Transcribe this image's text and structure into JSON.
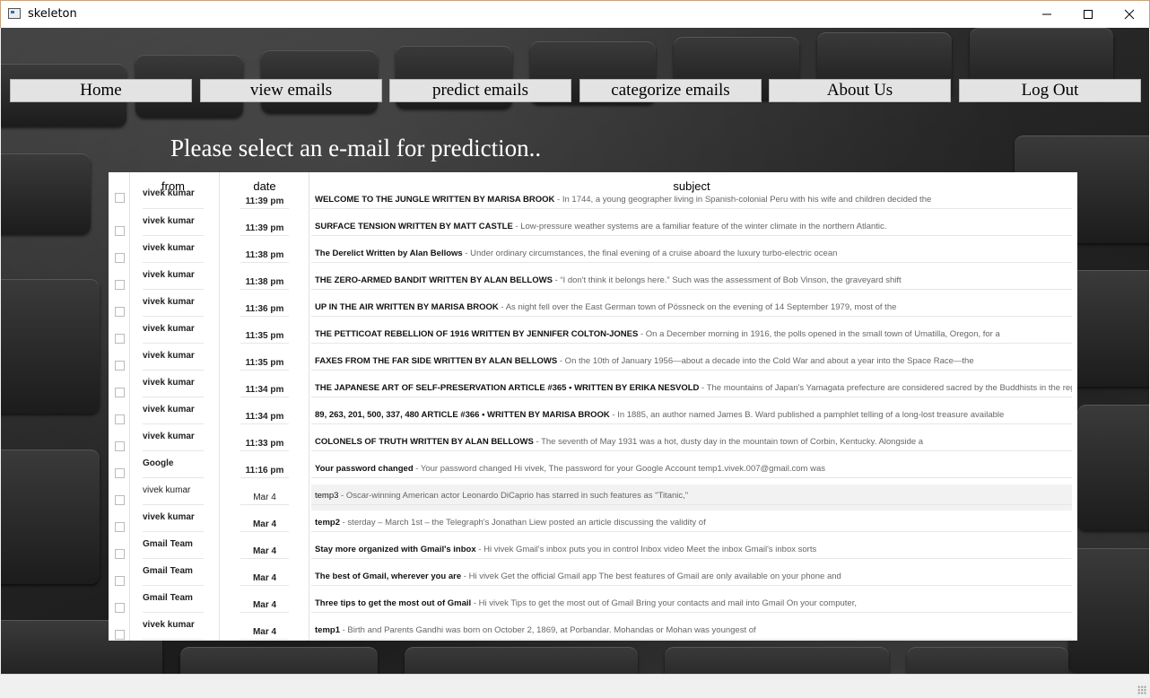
{
  "window": {
    "title": "skeleton"
  },
  "nav": [
    {
      "label": "Home"
    },
    {
      "label": "view emails"
    },
    {
      "label": "predict emails"
    },
    {
      "label": "categorize emails"
    },
    {
      "label": "About Us"
    },
    {
      "label": "Log Out"
    }
  ],
  "prompt": "Please select an e-mail for prediction..",
  "table": {
    "headers": {
      "from": "from",
      "date": "date",
      "subject": "subject"
    },
    "rows": [
      {
        "from": "vivek kumar",
        "date": "11:39 pm",
        "subject": "WELCOME TO THE JUNGLE WRITTEN BY MARISA BROOK",
        "snippet": " - In 1744, a young geographer living in Spanish-colonial Peru with his wife and children decided the",
        "read": false
      },
      {
        "from": "vivek kumar",
        "date": "11:39 pm",
        "subject": "SURFACE TENSION WRITTEN BY MATT CASTLE",
        "snippet": " - Low-pressure weather systems are a familiar feature of the winter climate in the northern Atlantic.",
        "read": false
      },
      {
        "from": "vivek kumar",
        "date": "11:38 pm",
        "subject": "The Derelict Written by Alan Bellows",
        "snippet": " - Under ordinary circumstances, the final evening of a cruise aboard the luxury turbo-electric ocean",
        "read": false
      },
      {
        "from": "vivek kumar",
        "date": "11:38 pm",
        "subject": "THE ZERO-ARMED BANDIT WRITTEN BY ALAN BELLOWS",
        "snippet": " - “I don't think it belongs here.” Such was the assessment of Bob Vinson, the graveyard shift",
        "read": false
      },
      {
        "from": "vivek kumar",
        "date": "11:36 pm",
        "subject": "UP IN THE AIR WRITTEN BY MARISA BROOK",
        "snippet": " - As night fell over the East German town of Pössneck on the evening of 14 September 1979, most of the",
        "read": false
      },
      {
        "from": "vivek kumar",
        "date": "11:35 pm",
        "subject": "THE PETTICOAT REBELLION OF 1916 WRITTEN BY JENNIFER COLTON-JONES",
        "snippet": " - On a December morning in 1916, the polls opened in the small town of Umatilla, Oregon, for a",
        "read": false
      },
      {
        "from": "vivek kumar",
        "date": "11:35 pm",
        "subject": "FAXES FROM THE FAR SIDE WRITTEN BY ALAN BELLOWS",
        "snippet": " - On the 10th of January 1956—about a decade into the Cold War and about a year into the Space Race—the",
        "read": false
      },
      {
        "from": "vivek kumar",
        "date": "11:34 pm",
        "subject": "THE JAPANESE ART OF SELF-PRESERVATION ARTICLE #365 • WRITTEN BY ERIKA NESVOLD",
        "snippet": " - The mountains of Japan's Yamagata prefecture are considered sacred by the Buddhists in the reg",
        "read": false
      },
      {
        "from": "vivek kumar",
        "date": "11:34 pm",
        "subject": "89, 263, 201, 500, 337, 480 ARTICLE #366 • WRITTEN BY MARISA BROOK",
        "snippet": " - In 1885, an author named James B. Ward published a pamphlet telling of a long-lost treasure available",
        "read": false
      },
      {
        "from": "vivek kumar",
        "date": "11:33 pm",
        "subject": "COLONELS OF TRUTH WRITTEN BY ALAN BELLOWS",
        "snippet": " - The seventh of May 1931 was a hot, dusty day in the mountain town of Corbin, Kentucky. Alongside a",
        "read": false
      },
      {
        "from": "Google",
        "date": "11:16 pm",
        "subject": "Your password changed",
        "snippet": " - Your password changed Hi vivek, The password for your Google Account temp1.vivek.007@gmail.com was",
        "read": false
      },
      {
        "from": "vivek kumar",
        "date": "Mar 4",
        "subject": "temp3",
        "snippet": " - Oscar-winning American actor Leonardo DiCaprio has starred in such features as \"Titanic,\"",
        "read": true
      },
      {
        "from": "vivek kumar",
        "date": "Mar 4",
        "subject": "temp2",
        "snippet": " - sterday – March 1st – the Telegraph's Jonathan Liew posted an article discussing the validity of",
        "read": false
      },
      {
        "from": "Gmail Team",
        "date": "Mar 4",
        "subject": "Stay more organized with Gmail's inbox",
        "snippet": " - Hi vivek Gmail's inbox puts you in control Inbox video Meet the inbox Gmail's inbox sorts",
        "read": false
      },
      {
        "from": "Gmail Team",
        "date": "Mar 4",
        "subject": "The best of Gmail, wherever you are",
        "snippet": " - Hi vivek Get the official Gmail app The best features of Gmail are only available on your phone and",
        "read": false
      },
      {
        "from": "Gmail Team",
        "date": "Mar 4",
        "subject": "Three tips to get the most out of Gmail",
        "snippet": " - Hi vivek Tips to get the most out of Gmail Bring your contacts and mail into Gmail On your computer,",
        "read": false
      },
      {
        "from": "vivek kumar",
        "date": "Mar 4",
        "subject": "temp1",
        "snippet": " - Birth and Parents Gandhi was born on October 2, 1869, at Porbandar. Mohandas or Mohan was youngest of",
        "read": false
      }
    ]
  }
}
